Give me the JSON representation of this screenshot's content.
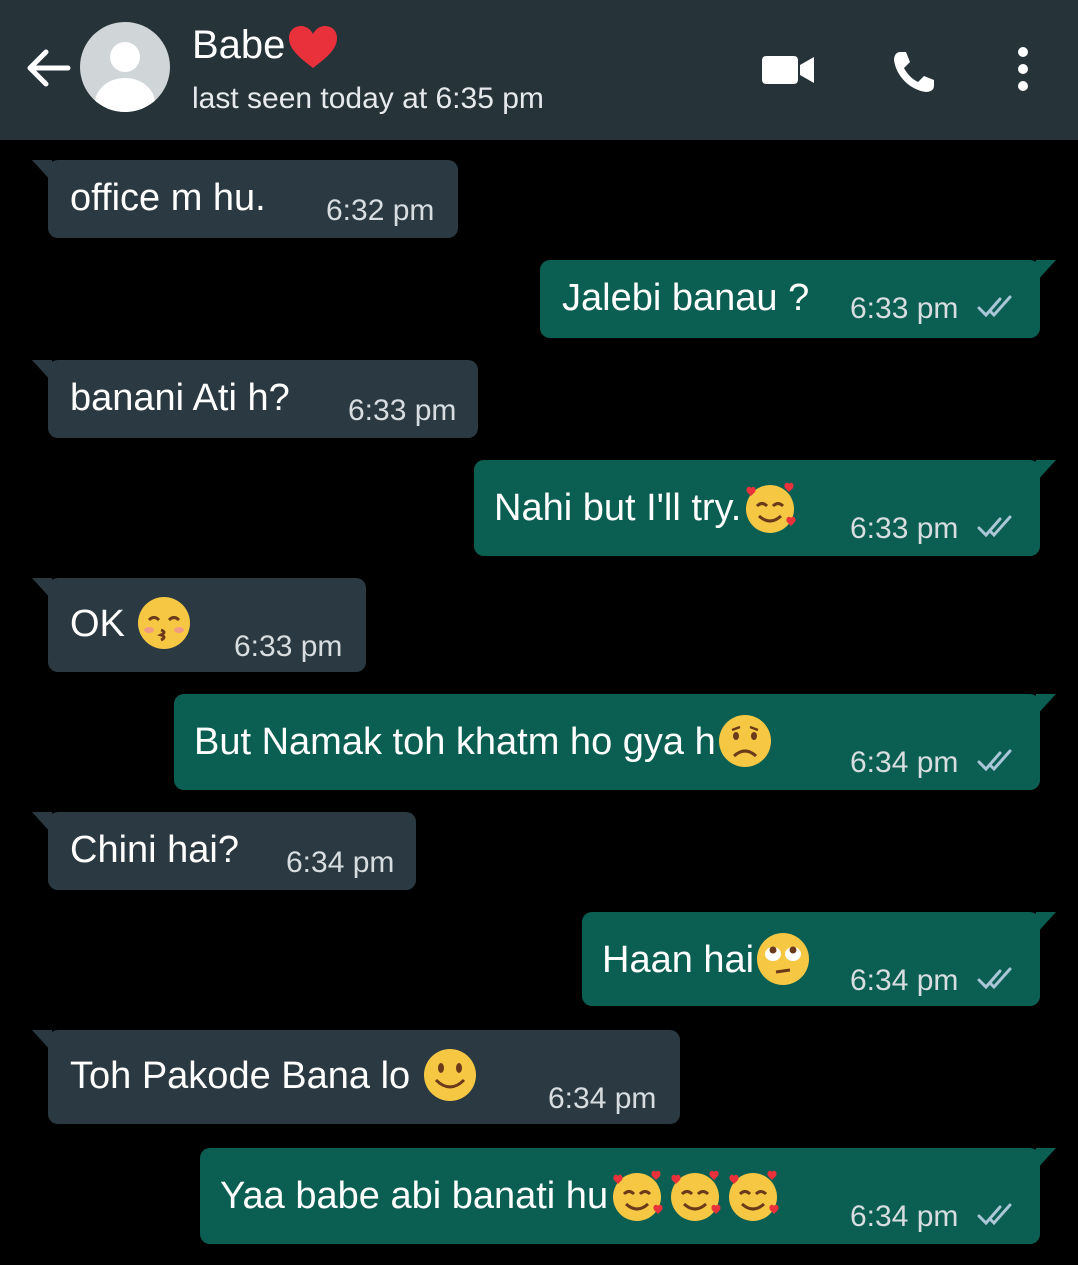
{
  "header": {
    "contact_name": "Babe",
    "status": "last seen today at 6:35 pm"
  },
  "colors": {
    "header_bg": "#263338",
    "chat_bg": "#000000",
    "incoming_bubble": "#2b3a42",
    "outgoing_bubble": "#0b5e52"
  },
  "messages": [
    {
      "direction": "incoming",
      "text": "office m hu.",
      "time": "6:32 pm"
    },
    {
      "direction": "outgoing",
      "text": "Jalebi banau ?",
      "time": "6:33 pm",
      "status": "read"
    },
    {
      "direction": "incoming",
      "text": "banani Ati h?",
      "time": "6:33 pm"
    },
    {
      "direction": "outgoing",
      "text": "Nahi but I'll try.",
      "emoji": [
        "smiling-face-with-hearts"
      ],
      "time": "6:33 pm",
      "status": "read"
    },
    {
      "direction": "incoming",
      "text": "OK",
      "emoji": [
        "kissing-face"
      ],
      "time": "6:33 pm"
    },
    {
      "direction": "outgoing",
      "text": "But Namak toh khatm ho gya h",
      "emoji": [
        "frowning-face"
      ],
      "time": "6:34 pm",
      "status": "read"
    },
    {
      "direction": "incoming",
      "text": "Chini hai?",
      "time": "6:34 pm"
    },
    {
      "direction": "outgoing",
      "text": "Haan hai",
      "emoji": [
        "eye-roll-face"
      ],
      "time": "6:34 pm",
      "status": "read"
    },
    {
      "direction": "incoming",
      "text": "Toh Pakode Bana lo",
      "emoji": [
        "smiling-face"
      ],
      "time": "6:34 pm"
    },
    {
      "direction": "outgoing",
      "text": "Yaa babe abi banati hu",
      "emoji": [
        "smiling-face-with-hearts",
        "smiling-face-with-hearts",
        "smiling-face-with-hearts"
      ],
      "time": "6:34 pm",
      "status": "read"
    }
  ]
}
